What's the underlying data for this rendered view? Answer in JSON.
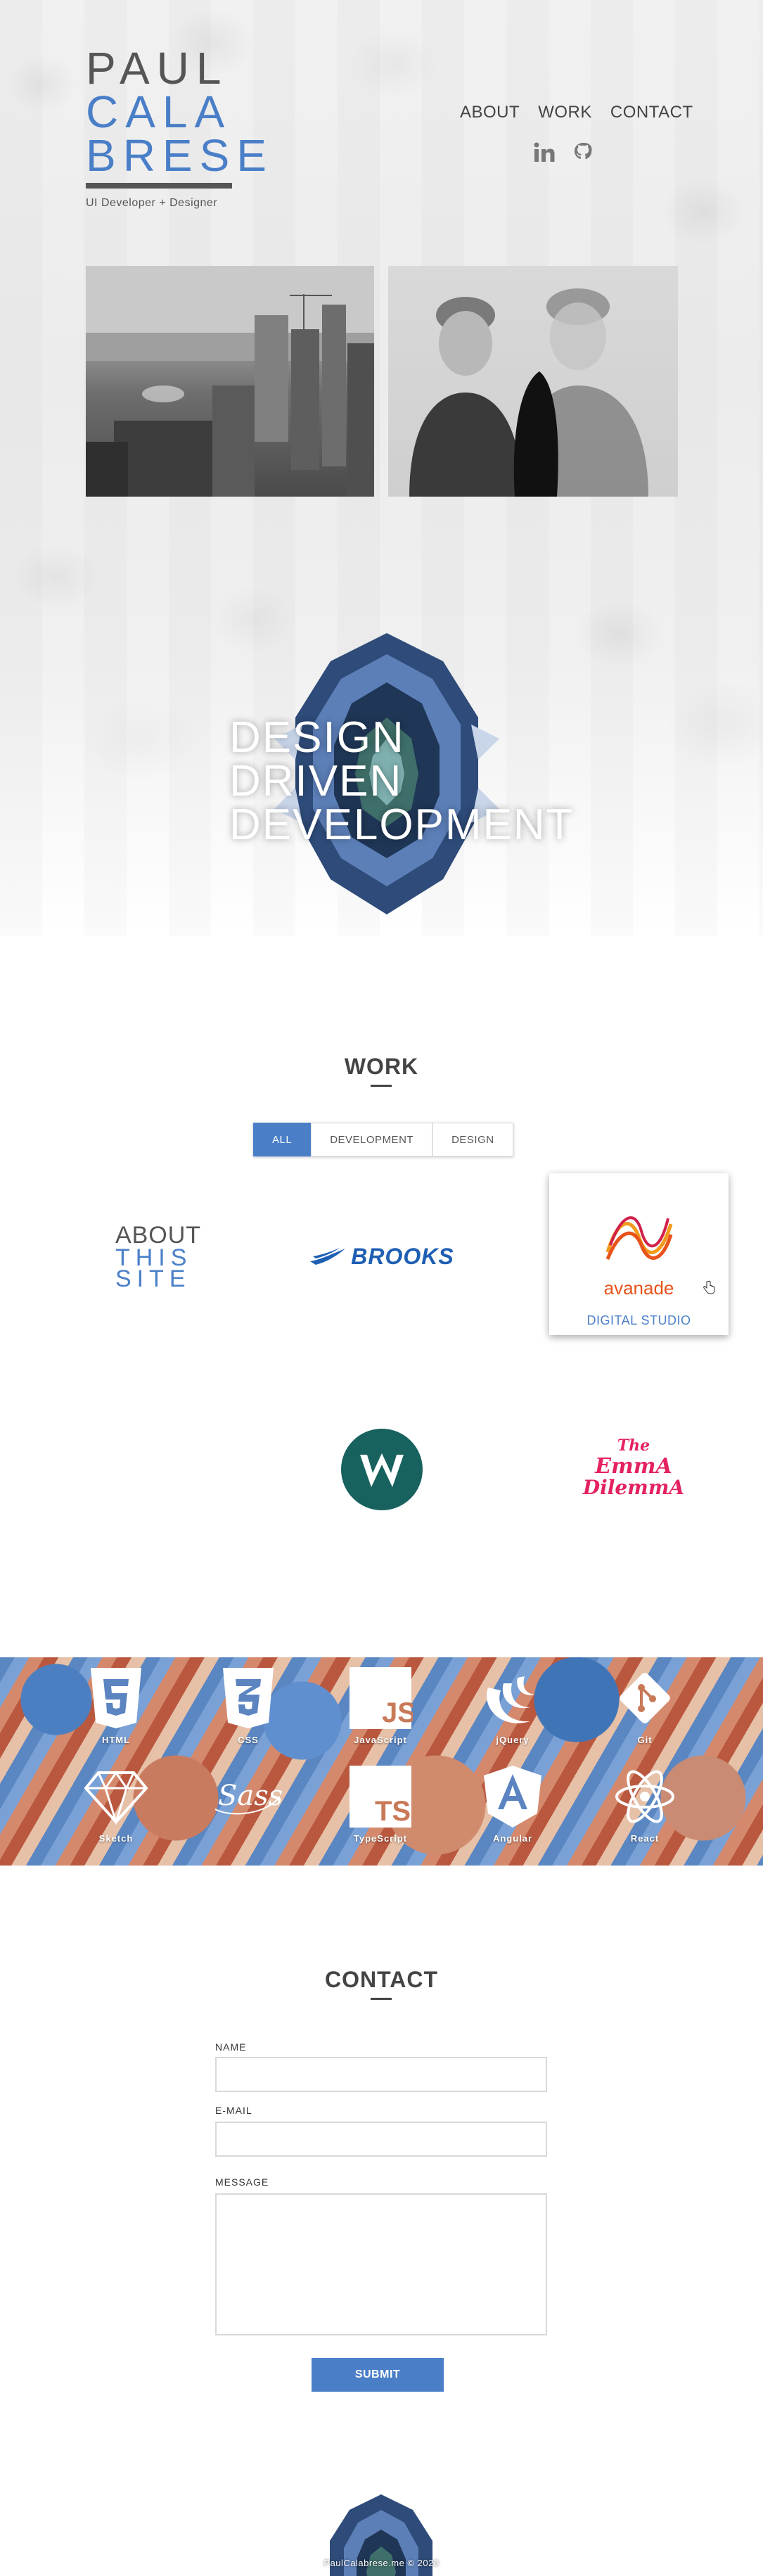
{
  "brand": {
    "line1": "PAUL",
    "line2": "CALA",
    "line3": "BRESE",
    "tagline": "UI Developer + Designer",
    "primary_color": "#4a7fc8",
    "text_color": "#555555"
  },
  "nav": {
    "about": "ABOUT",
    "work": "WORK",
    "contact": "CONTACT",
    "social": [
      "linkedin-icon",
      "github-icon"
    ]
  },
  "hero": {
    "photos": [
      "city-photo",
      "people-photo"
    ],
    "headline_1": "DESIGN",
    "headline_2": "DRIVEN",
    "headline_3": "DEVELOPMENT"
  },
  "work": {
    "title": "WORK",
    "filters": [
      "ALL",
      "DEVELOPMENT",
      "DESIGN"
    ],
    "active_filter": "ALL",
    "about_site_1": "ABOUT",
    "about_site_2": "THIS",
    "about_site_3": "SITE",
    "brooks": "BROOKS",
    "avanade": "avanade",
    "avanade_caption": "DIGITAL STUDIO",
    "emma_1": "The",
    "emma_2": "EmmA",
    "emma_3": "DilemmA"
  },
  "skills": [
    {
      "icon": "html5-icon",
      "label": "HTML"
    },
    {
      "icon": "css3-icon",
      "label": "CSS"
    },
    {
      "icon": "javascript-icon",
      "label": "JavaScript"
    },
    {
      "icon": "jquery-icon",
      "label": "jQuery"
    },
    {
      "icon": "git-icon",
      "label": "Git"
    },
    {
      "icon": "sketch-icon",
      "label": "Sketch"
    },
    {
      "icon": "sass-icon",
      "label": ""
    },
    {
      "icon": "typescript-icon",
      "label": "TypeScript"
    },
    {
      "icon": "angular-icon",
      "label": "Angular"
    },
    {
      "icon": "react-icon",
      "label": "React"
    }
  ],
  "skill_glyphs": {
    "js": "JS",
    "ts": "TS",
    "sass": "Sass"
  },
  "contact": {
    "title": "CONTACT",
    "name_label": "NAME",
    "email_label": "E-MAIL",
    "message_label": "MESSAGE",
    "name_value": "",
    "email_value": "",
    "message_value": "",
    "submit_label": "SUBMIT"
  },
  "footer": {
    "text": "PaulCalabrese.me © 2020"
  }
}
